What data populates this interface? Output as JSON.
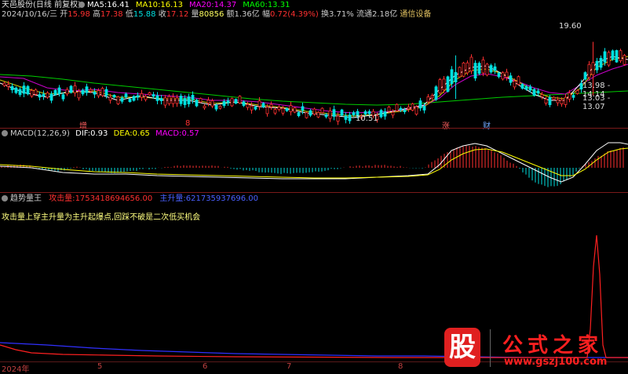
{
  "header": {
    "title": "天邑股份(日线 前复权)",
    "date": "2024/10/16/三",
    "open_label": "开",
    "open": "15.98",
    "high_label": "高",
    "high": "17.38",
    "low_label": "低",
    "low": "15.88",
    "close_label": "收",
    "close": "17.12",
    "vol_label": "量",
    "vol": "80856",
    "amount_label": "额",
    "amount": "1.36亿",
    "change_label": "幅",
    "change": "0.72(4.39%)",
    "turnover_label": "换",
    "turnover": "3.71%",
    "float_label": "流通",
    "float": "2.18亿",
    "industry": "通信设备"
  },
  "ma": [
    {
      "label": "MA5:",
      "value": "16.41",
      "color": "#ffffff"
    },
    {
      "label": "MA10:",
      "value": "16.13",
      "color": "#ffff00"
    },
    {
      "label": "MA20:",
      "value": "14.37",
      "color": "#ff00ff"
    },
    {
      "label": "MA60:",
      "value": "13.31",
      "color": "#00ff00"
    }
  ],
  "price_annotations": {
    "high_marker": "19.60",
    "low_marker": "10.51",
    "right_1": "13.98 - 14.14",
    "right_2": "13.03 - 13.07"
  },
  "event_markers": [
    {
      "label": "增",
      "color": "#ff6060"
    },
    {
      "label": "8",
      "color": "#ff3030"
    },
    {
      "label": "涨",
      "color": "#ff6060"
    },
    {
      "label": "财",
      "color": "#6fa8ff"
    }
  ],
  "macd": {
    "title": "MACD(12,26,9)",
    "dif_label": "DIF:",
    "dif": "0.93",
    "dea_label": "DEA:",
    "dea": "0.65",
    "macd_label": "MACD:",
    "macd": "0.57"
  },
  "indicator": {
    "title": "趋势量王",
    "attack_label": "攻击量:",
    "attack_value": "1753418694656.00",
    "main_label": "主升量:",
    "main_value": "621735937696.00",
    "hint": "攻击量上穿主升量为主升起爆点,回踩不破是二次低买机会"
  },
  "time_axis": [
    "2024年",
    "5",
    "6",
    "7",
    "8"
  ],
  "watermark": {
    "big": "股",
    "text": "公式之家",
    "url": "www.gszj100.com"
  },
  "colors": {
    "up": "#ff3030",
    "down": "#00e0e0",
    "separator": "#7a1a1a"
  }
}
